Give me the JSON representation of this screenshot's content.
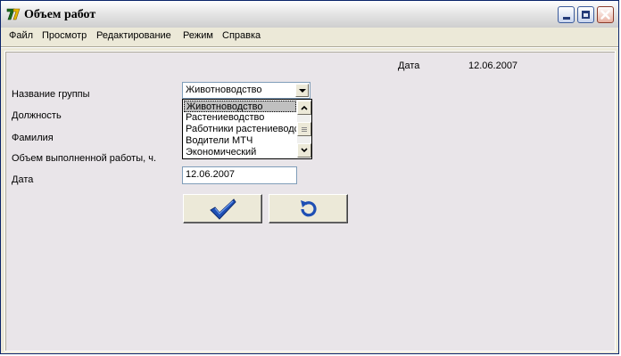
{
  "window": {
    "title": "Объем работ",
    "icon": "app-logo-icon"
  },
  "menu": {
    "items": [
      "Файл",
      "Просмотр",
      "Редактирование",
      "Режим",
      "Справка"
    ]
  },
  "header": {
    "date_label": "Дата",
    "date_value": "12.06.2007"
  },
  "form": {
    "group_label": "Название группы",
    "position_label": "Должность",
    "surname_label": "Фамилия",
    "work_label": "Объем выполненной работы, ч.",
    "date_label": "Дата",
    "group_value": "Животноводство",
    "date_value": "12.06.2007"
  },
  "dropdown": {
    "options": [
      "Животноводство",
      "Растениеводство",
      "Работники растениеводства",
      "Водители МТЧ",
      "Экономический"
    ],
    "selected_index": 0
  },
  "buttons": {
    "confirm_icon": "checkmark-icon",
    "refresh_icon": "refresh-icon"
  },
  "colors": {
    "title_gradient_top": "#ffffff",
    "client_bg": "#e9e5e9",
    "checkmark": "#1e4fb4"
  }
}
